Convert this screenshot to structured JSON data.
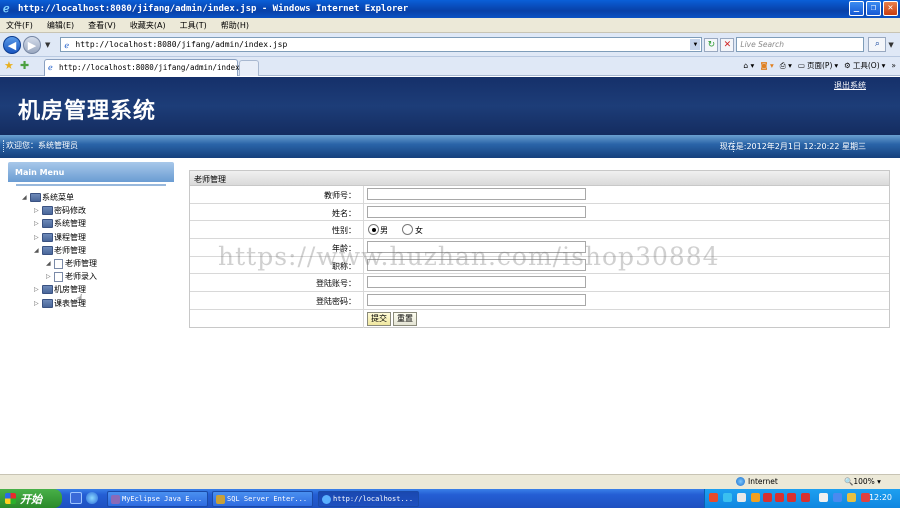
{
  "window": {
    "title": "http://localhost:8080/jifang/admin/index.jsp - Windows Internet Explorer"
  },
  "menu": [
    "文件(F)",
    "编辑(E)",
    "查看(V)",
    "收藏夹(A)",
    "工具(T)",
    "帮助(H)"
  ],
  "address": {
    "url": "http://localhost:8080/jifang/admin/index.jsp",
    "search_placeholder": "Live Search"
  },
  "tab": {
    "title": "http://localhost:8080/jifang/admin/index.jsp"
  },
  "commandbar": {
    "page": "页面(P)",
    "tools": "工具(O)"
  },
  "header": {
    "app_title": "机房管理系统",
    "logout": "退出系统",
    "welcome": "欢迎您：系统管理员",
    "datetime": "现在是:2012年2月1日  12:20:22 星期三"
  },
  "sidebar": {
    "heading": "Main Menu",
    "root": "系统菜单",
    "items": [
      {
        "label": "密码修改",
        "level": 1,
        "type": "folder",
        "expanded": false
      },
      {
        "label": "系统管理",
        "level": 1,
        "type": "folder",
        "expanded": false
      },
      {
        "label": "课程管理",
        "level": 1,
        "type": "folder",
        "expanded": false
      },
      {
        "label": "老师管理",
        "level": 1,
        "type": "folder",
        "expanded": true
      },
      {
        "label": "老师管理",
        "level": 2,
        "type": "file",
        "expanded": true
      },
      {
        "label": "老师录入",
        "level": 2,
        "type": "file",
        "expanded": false
      },
      {
        "label": "机房管理",
        "level": 1,
        "type": "folder",
        "expanded": false
      },
      {
        "label": "课表管理",
        "level": 1,
        "type": "folder",
        "expanded": false
      }
    ]
  },
  "form": {
    "heading": "老师管理",
    "fields": {
      "teacher_no": "教师号：",
      "name": "姓名：",
      "gender": "性别：",
      "age": "年龄：",
      "title": "职称：",
      "login_account": "登陆账号：",
      "login_password": "登陆密码："
    },
    "gender_options": {
      "male": "男",
      "female": "女",
      "selected": "男"
    },
    "submit": "提交",
    "reset": "重置"
  },
  "watermark": "https://www.huzhan.com/ishop30884",
  "statusbar": {
    "zone": "Internet",
    "zoom": "100%"
  },
  "taskbar": {
    "start": "开始",
    "tasks": [
      "MyEclipse Java E...",
      "SQL Server Enter...",
      "http://localhost..."
    ],
    "clock": "12:20"
  }
}
